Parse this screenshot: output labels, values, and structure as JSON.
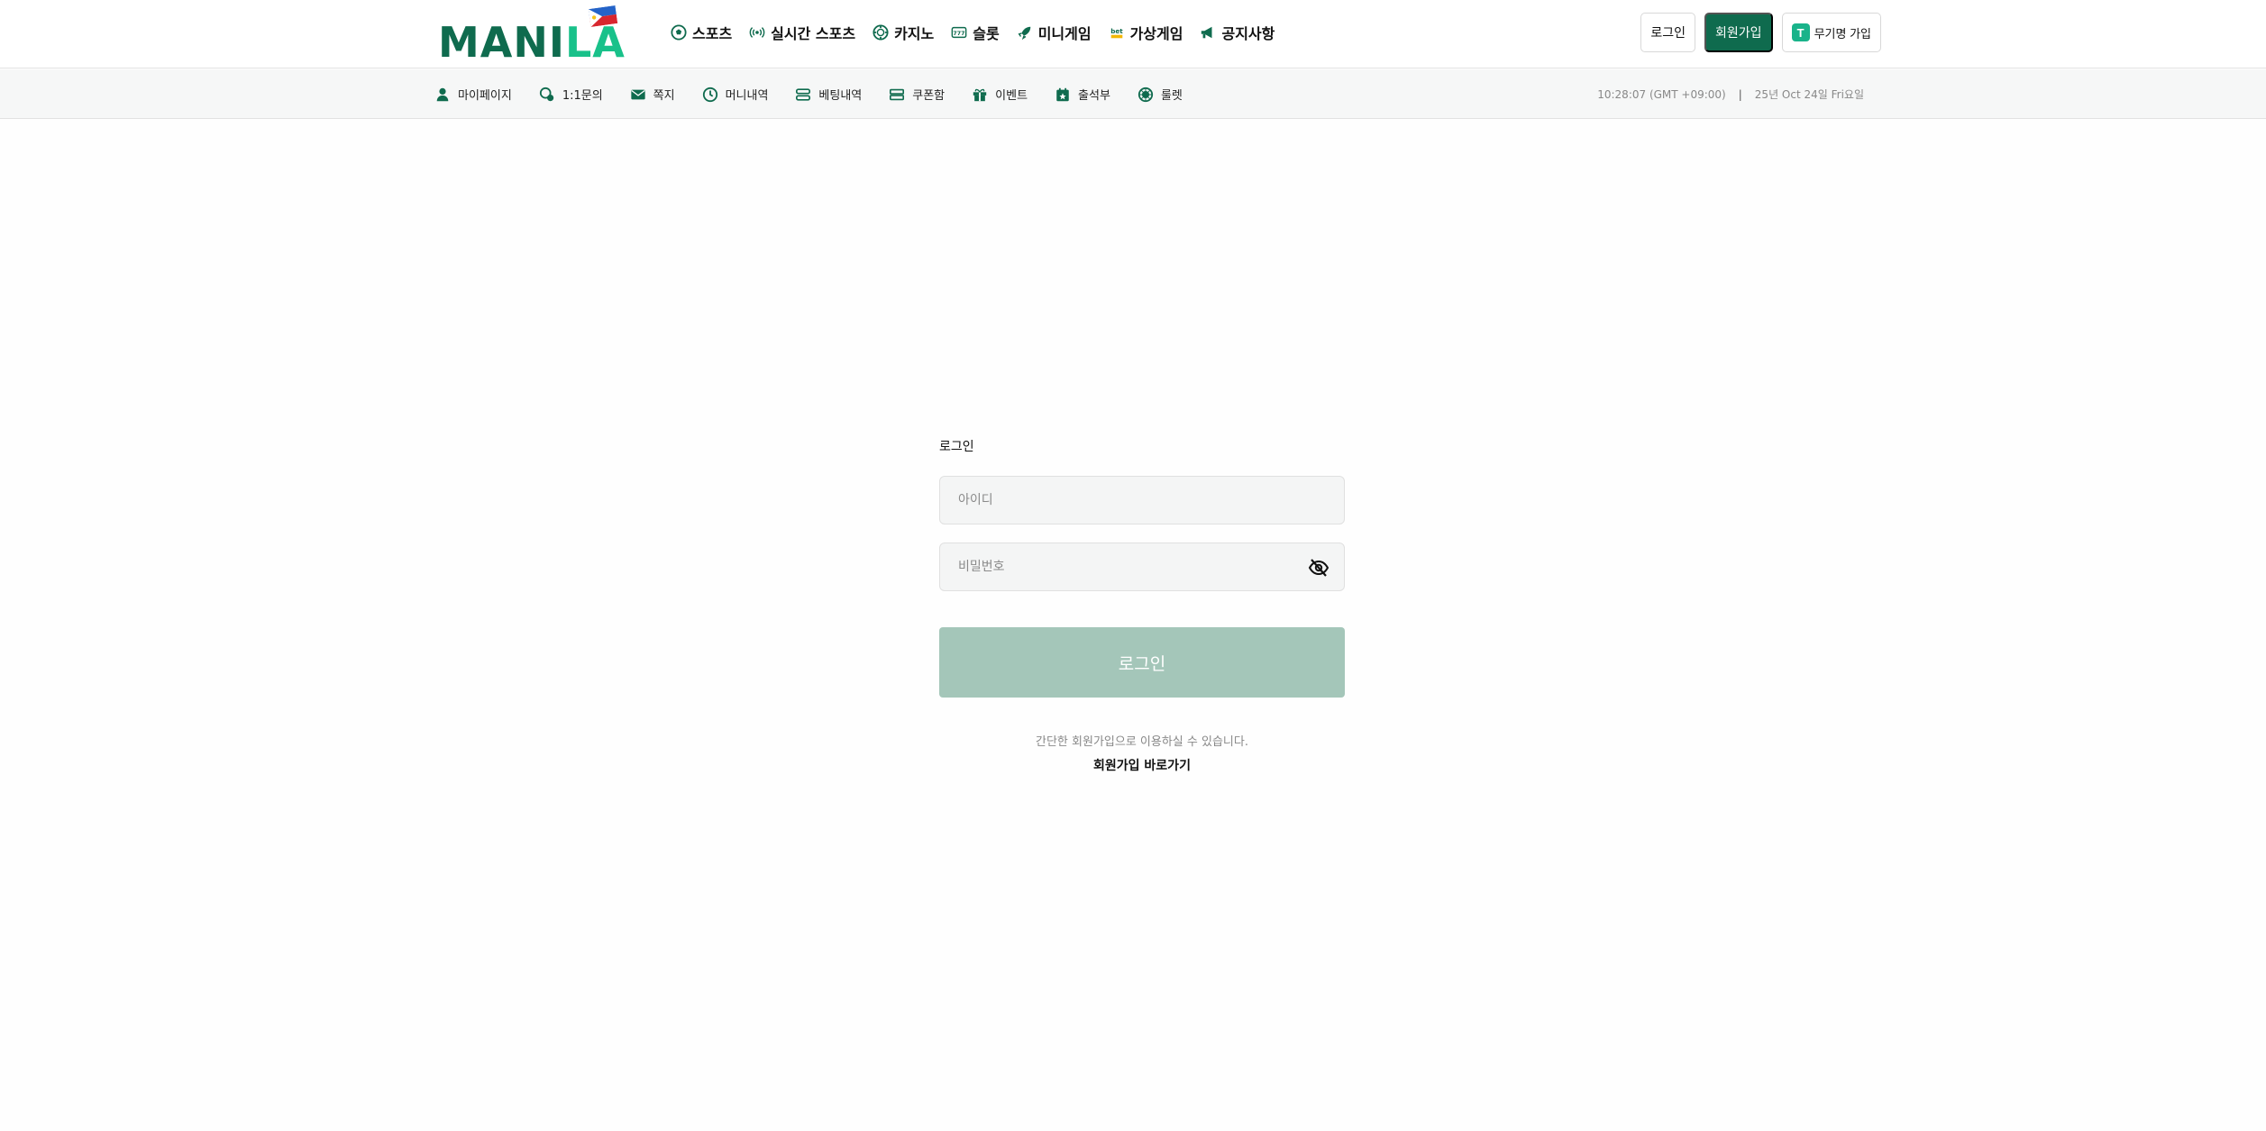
{
  "header": {
    "logo_text_main": "MANI",
    "logo_text_accent": "LA",
    "nav": [
      {
        "label": "스포츠",
        "icon": "soccer-ball-icon"
      },
      {
        "label": "실시간 스포츠",
        "icon": "broadcast-icon"
      },
      {
        "label": "카지노",
        "icon": "casino-chip-icon"
      },
      {
        "label": "슬롯",
        "icon": "slot-machine-icon"
      },
      {
        "label": "미니게임",
        "icon": "rocket-icon"
      },
      {
        "label": "가상게임",
        "icon": "bet-icon"
      },
      {
        "label": "공지사항",
        "icon": "megaphone-icon"
      }
    ],
    "login_label": "로그인",
    "signup_label": "회원가입",
    "telegram_badge": "T",
    "telegram_label": "무기명 가입"
  },
  "subnav": {
    "items": [
      {
        "label": "마이페이지",
        "icon": "user-icon"
      },
      {
        "label": "1:1문의",
        "icon": "chat-icon"
      },
      {
        "label": "쪽지",
        "icon": "envelope-icon"
      },
      {
        "label": "머니내역",
        "icon": "clock-icon"
      },
      {
        "label": "베팅내역",
        "icon": "list-icon"
      },
      {
        "label": "쿠폰함",
        "icon": "coupon-icon"
      },
      {
        "label": "이벤트",
        "icon": "gift-icon"
      },
      {
        "label": "출석부",
        "icon": "calendar-icon"
      },
      {
        "label": "룰렛",
        "icon": "roulette-icon"
      }
    ],
    "time": "10:28:07 (GMT +09:00)",
    "separator": "|",
    "date": "25년 Oct 24일 Fri요일"
  },
  "login": {
    "title": "로그인",
    "id_placeholder": "아이디",
    "password_placeholder": "비밀번호",
    "submit_label": "로그인",
    "hint": "간단한 회원가입으로 이용하실 수 있습니다.",
    "signup_link": "회원가입 바로가기"
  },
  "colors": {
    "brand": "#0f6b4e",
    "brand_accent": "#19c18a",
    "login_button": "#a4c6b9"
  }
}
